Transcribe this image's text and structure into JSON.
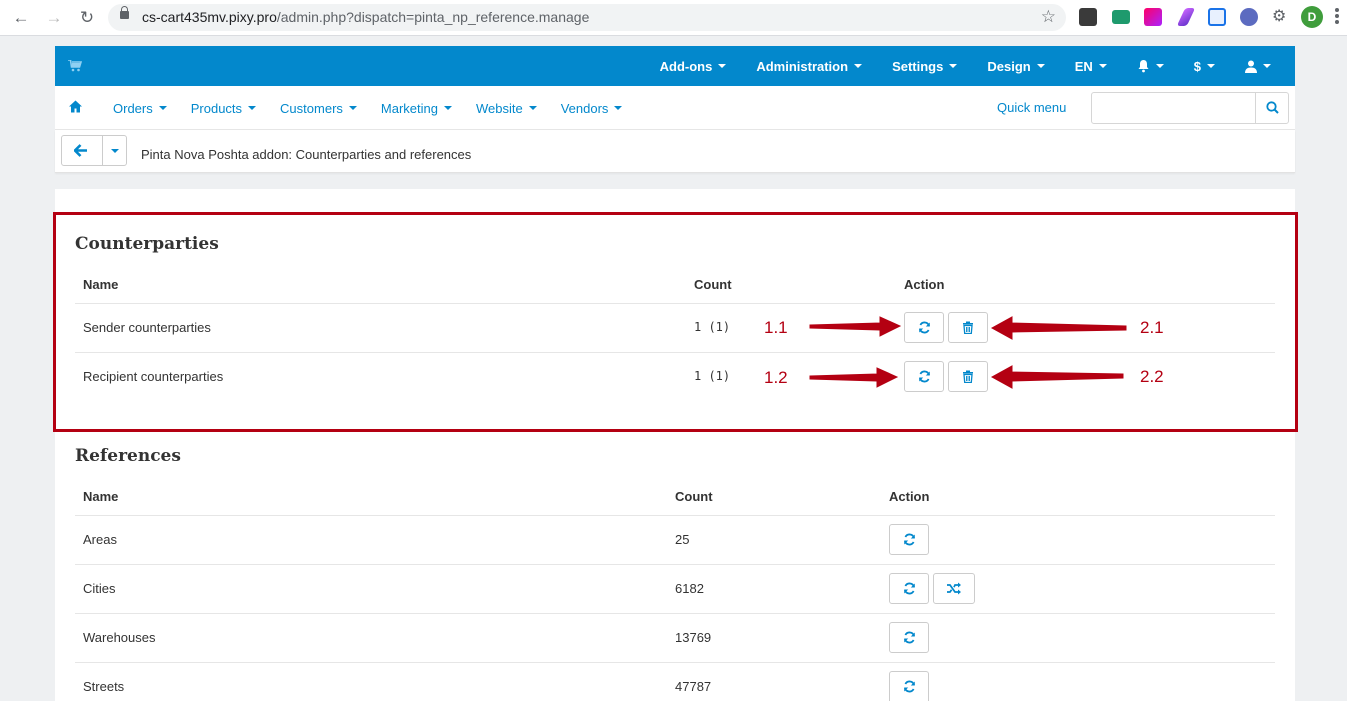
{
  "browser": {
    "url_host": "cs-cart435mv.pixy.pro",
    "url_path": "/admin.php?dispatch=pinta_np_reference.manage",
    "profile_initial": "D"
  },
  "topbar": {
    "items": [
      {
        "label": "Add-ons"
      },
      {
        "label": "Administration"
      },
      {
        "label": "Settings"
      },
      {
        "label": "Design"
      },
      {
        "label": "EN"
      },
      {
        "label": ""
      },
      {
        "label": "$"
      },
      {
        "label": ""
      }
    ]
  },
  "mainmenu": {
    "items": [
      {
        "label": "Orders"
      },
      {
        "label": "Products"
      },
      {
        "label": "Customers"
      },
      {
        "label": "Marketing"
      },
      {
        "label": "Website"
      },
      {
        "label": "Vendors"
      }
    ],
    "quick_menu": "Quick menu",
    "search_value": ""
  },
  "page": {
    "title": "Pinta Nova Poshta addon: Counterparties and references"
  },
  "counterparties": {
    "title": "Counterparties",
    "headers": {
      "name": "Name",
      "count": "Count",
      "action": "Action"
    },
    "rows": [
      {
        "name": "Sender counterparties",
        "count": "1 (1)"
      },
      {
        "name": "Recipient counterparties",
        "count": "1 (1)"
      }
    ]
  },
  "references": {
    "title": "References",
    "headers": {
      "name": "Name",
      "count": "Count",
      "action": "Action"
    },
    "rows": [
      {
        "name": "Areas",
        "count": "25"
      },
      {
        "name": "Cities",
        "count": "6182"
      },
      {
        "name": "Warehouses",
        "count": "13769"
      },
      {
        "name": "Streets",
        "count": "47787"
      }
    ]
  },
  "annotations": {
    "labels": [
      "1.1",
      "1.2",
      "2.1",
      "2.2"
    ]
  },
  "colors": {
    "accent": "#0388cc",
    "annotation": "#b40012"
  }
}
